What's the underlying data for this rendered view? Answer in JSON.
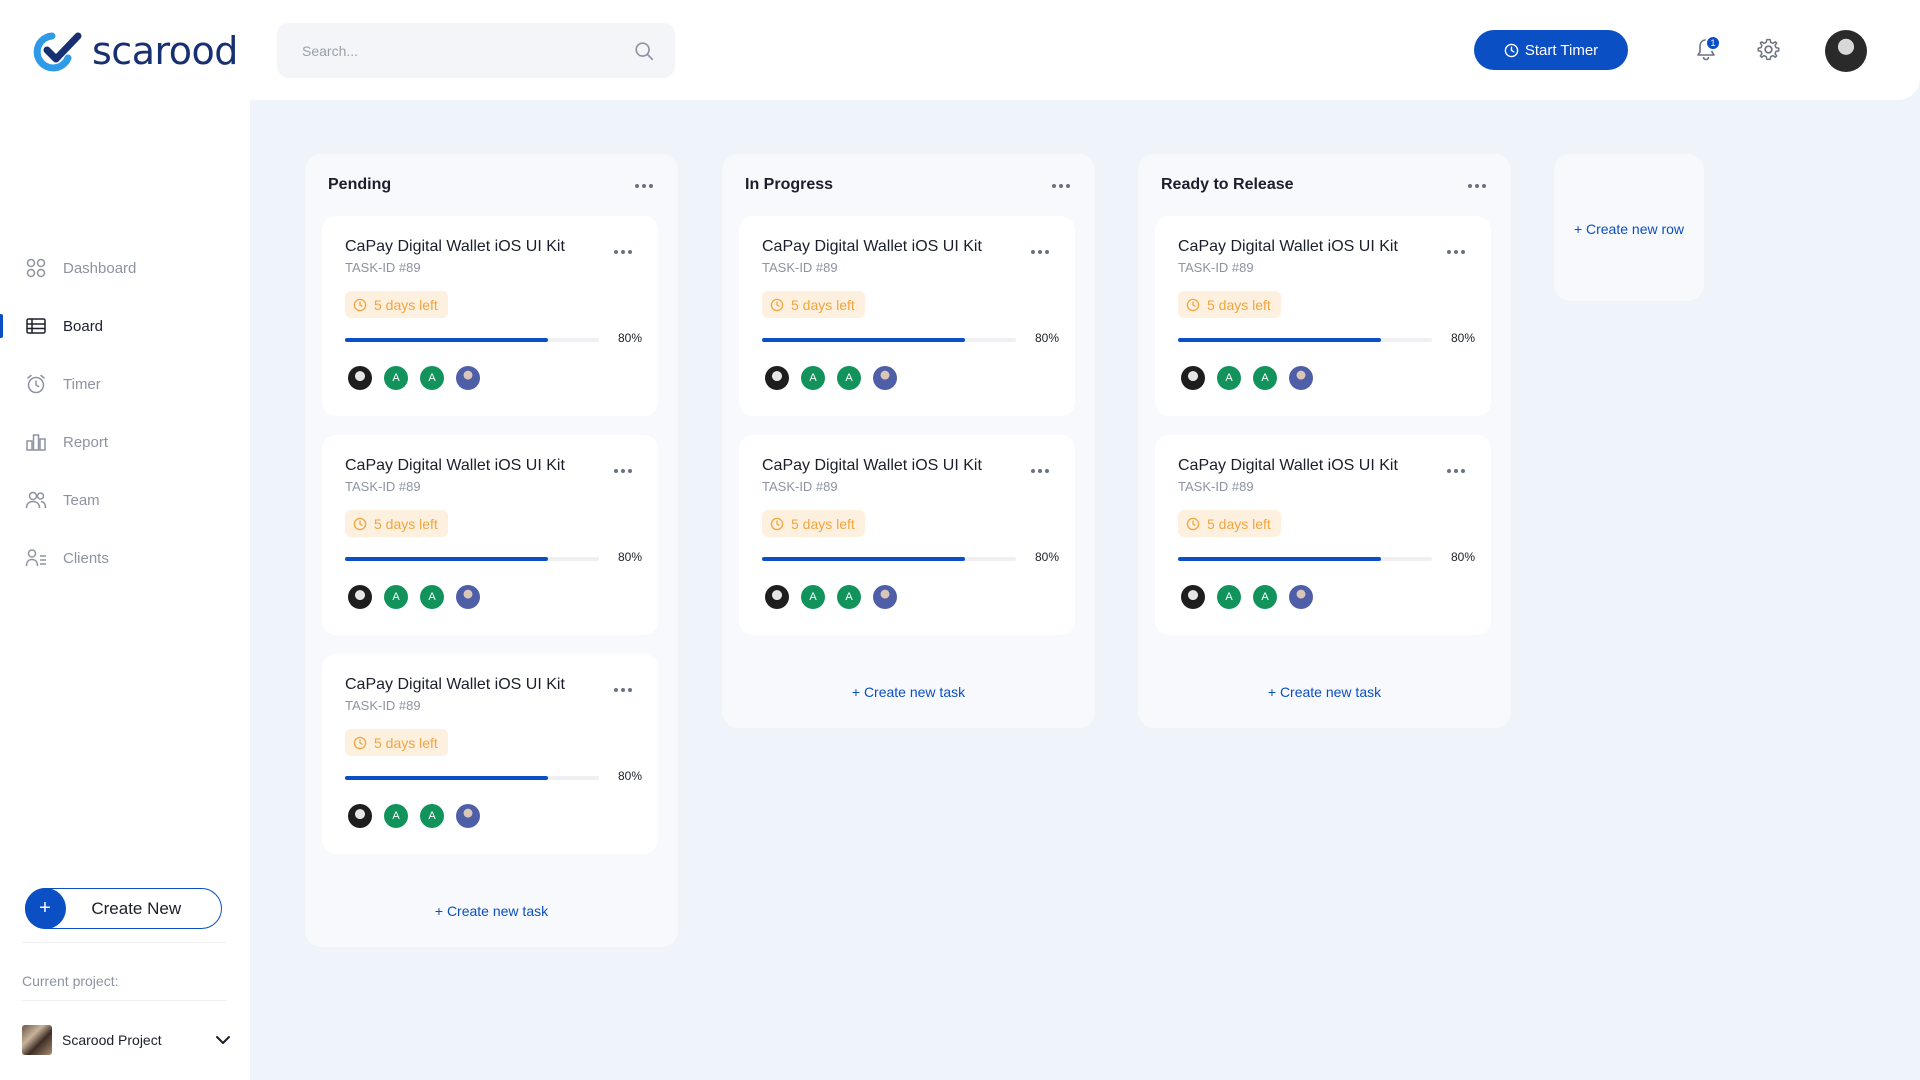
{
  "app": {
    "brand": "scarood"
  },
  "header": {
    "search": {
      "placeholder": "Search...",
      "value": ""
    },
    "start_timer": "Start Timer",
    "notification_count": "1"
  },
  "sidebar": {
    "items": [
      {
        "label": "Dashboard",
        "icon": "dashboard-icon",
        "active": false
      },
      {
        "label": "Board",
        "icon": "board-icon",
        "active": true
      },
      {
        "label": "Timer",
        "icon": "timer-icon",
        "active": false
      },
      {
        "label": "Report",
        "icon": "report-icon",
        "active": false
      },
      {
        "label": "Team",
        "icon": "team-icon",
        "active": false
      },
      {
        "label": "Clients",
        "icon": "clients-icon",
        "active": false
      }
    ],
    "create_new": "Create New",
    "current_project_label": "Current project:",
    "project_name": "Scarood Project"
  },
  "board": {
    "columns": [
      {
        "title": "Pending",
        "cards": [
          {
            "title": "CaPay Digital Wallet iOS UI Kit",
            "task_id": "TASK-ID #89",
            "due": "5 days left",
            "progress": "80%",
            "members": [
              "photo",
              "A",
              "A",
              "photo-blue"
            ]
          },
          {
            "title": "CaPay Digital Wallet iOS UI Kit",
            "task_id": "TASK-ID #89",
            "due": "5 days left",
            "progress": "80%",
            "members": [
              "photo",
              "A",
              "A",
              "photo-blue"
            ]
          },
          {
            "title": "CaPay Digital Wallet iOS UI Kit",
            "task_id": "TASK-ID #89",
            "due": "5 days left",
            "progress": "80%",
            "members": [
              "photo",
              "A",
              "A",
              "photo-blue"
            ]
          }
        ],
        "create_task": "+ Create new task"
      },
      {
        "title": "In Progress",
        "cards": [
          {
            "title": "CaPay Digital Wallet iOS UI Kit",
            "task_id": "TASK-ID #89",
            "due": "5 days left",
            "progress": "80%",
            "members": [
              "photo",
              "A",
              "A",
              "photo-blue"
            ]
          },
          {
            "title": "CaPay Digital Wallet iOS UI Kit",
            "task_id": "TASK-ID #89",
            "due": "5 days left",
            "progress": "80%",
            "members": [
              "photo",
              "A",
              "A",
              "photo-blue"
            ]
          }
        ],
        "create_task": "+ Create new task"
      },
      {
        "title": "Ready to Release",
        "cards": [
          {
            "title": "CaPay Digital Wallet iOS UI Kit",
            "task_id": "TASK-ID #89",
            "due": "5 days left",
            "progress": "80%",
            "members": [
              "photo",
              "A",
              "A",
              "photo-blue"
            ]
          },
          {
            "title": "CaPay Digital Wallet iOS UI Kit",
            "task_id": "TASK-ID #89",
            "due": "5 days left",
            "progress": "80%",
            "members": [
              "photo",
              "A",
              "A",
              "photo-blue"
            ]
          }
        ],
        "create_task": "+ Create new task"
      }
    ],
    "create_row": "+ Create new row"
  },
  "colors": {
    "accent": "#0b4fc4",
    "background": "#eff3fa",
    "due_bg": "#fdf0de",
    "due_text": "#f0a540",
    "member_green": "#12935c"
  }
}
